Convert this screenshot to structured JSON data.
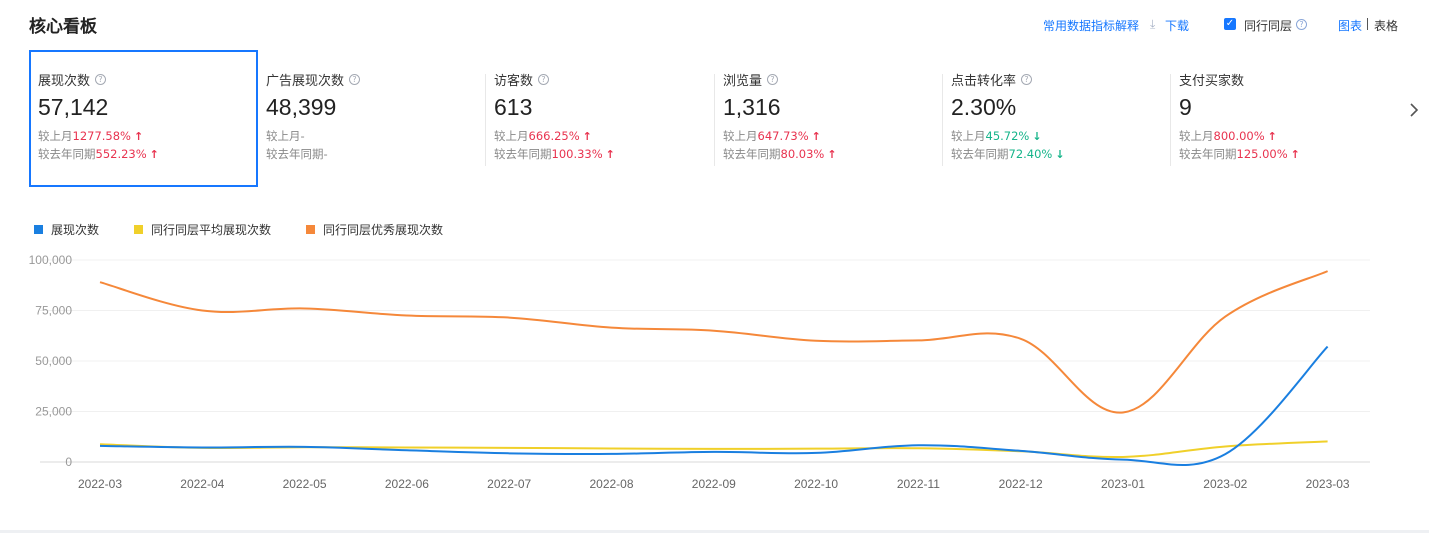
{
  "title": "核心看板",
  "toolbar": {
    "explain_label": "常用数据指标解释",
    "download_label": "下载",
    "peer_checked": true,
    "peer_label": "同行同层",
    "chart_tab": "图表",
    "table_tab": "表格"
  },
  "cards": [
    {
      "label": "展现次数",
      "value": "57,142",
      "mom_prefix": "较上月",
      "mom": "1277.58%",
      "mom_dir": "up",
      "yoy_prefix": "较去年同期",
      "yoy": "552.23%",
      "yoy_dir": "up",
      "help": true,
      "active": true
    },
    {
      "label": "广告展现次数",
      "value": "48,399",
      "mom_prefix": "较上月",
      "mom": "-",
      "mom_dir": "none",
      "yoy_prefix": "较去年同期",
      "yoy": "-",
      "yoy_dir": "none",
      "help": true,
      "active": false
    },
    {
      "label": "访客数",
      "value": "613",
      "mom_prefix": "较上月",
      "mom": "666.25%",
      "mom_dir": "up",
      "yoy_prefix": "较去年同期",
      "yoy": "100.33%",
      "yoy_dir": "up",
      "help": true,
      "active": false
    },
    {
      "label": "浏览量",
      "value": "1,316",
      "mom_prefix": "较上月",
      "mom": "647.73%",
      "mom_dir": "up",
      "yoy_prefix": "较去年同期",
      "yoy": "80.03%",
      "yoy_dir": "up",
      "help": true,
      "active": false
    },
    {
      "label": "点击转化率",
      "value": "2.30%",
      "mom_prefix": "较上月",
      "mom": "45.72%",
      "mom_dir": "down",
      "yoy_prefix": "较去年同期",
      "yoy": "72.40%",
      "yoy_dir": "down",
      "help": true,
      "active": false
    },
    {
      "label": "支付买家数",
      "value": "9",
      "mom_prefix": "较上月",
      "mom": "800.00%",
      "mom_dir": "up",
      "yoy_prefix": "较去年同期",
      "yoy": "125.00%",
      "yoy_dir": "up",
      "help": false,
      "active": false
    }
  ],
  "colors": {
    "accent": "#1677ff",
    "up": "#e8334f",
    "down": "#16b48a",
    "series_blue": "#1a7fe0",
    "series_yellow": "#f0d02a",
    "series_orange": "#f5883a"
  },
  "chart_data": {
    "type": "line",
    "x": [
      "2022-03",
      "2022-04",
      "2022-05",
      "2022-06",
      "2022-07",
      "2022-08",
      "2022-09",
      "2022-10",
      "2022-11",
      "2022-12",
      "2023-01",
      "2023-02",
      "2023-03"
    ],
    "y_ticks": [
      "0",
      "25,000",
      "50,000",
      "75,000",
      "100,000"
    ],
    "ylim": [
      0,
      100000
    ],
    "grid": true,
    "legend_position": "top-left",
    "series": [
      {
        "name": "展现次数",
        "color": "#1a7fe0",
        "values": [
          8000,
          7200,
          7500,
          5800,
          4300,
          4000,
          5000,
          4500,
          8300,
          5500,
          1200,
          3900,
          57142
        ]
      },
      {
        "name": "同行同层平均展现次数",
        "color": "#f0d02a",
        "values": [
          8800,
          7000,
          7300,
          7200,
          7000,
          6700,
          6500,
          6600,
          6800,
          5300,
          2500,
          7700,
          10200
        ]
      },
      {
        "name": "同行同层优秀展现次数",
        "color": "#f5883a",
        "values": [
          89000,
          75000,
          76000,
          72500,
          71500,
          66500,
          65000,
          60000,
          60200,
          61000,
          24500,
          72000,
          94500
        ]
      }
    ]
  }
}
